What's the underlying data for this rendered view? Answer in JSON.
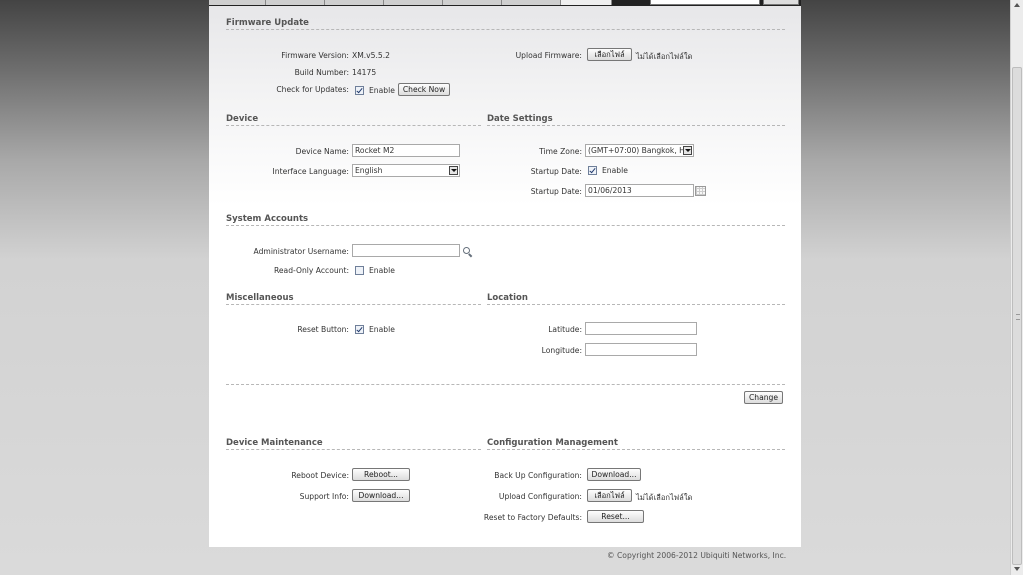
{
  "firmware": {
    "title": "Firmware Update",
    "version_label": "Firmware Version:",
    "version_value": "XM.v5.5.2",
    "build_label": "Build Number:",
    "build_value": "14175",
    "check_label": "Check for Updates:",
    "check_enable": "Enable",
    "check_now": "Check Now",
    "upload_label": "Upload Firmware:",
    "choose_file": "เลือกไฟล์",
    "no_file": "ไม่ได้เลือกไฟล์ใด"
  },
  "device": {
    "title": "Device",
    "name_label": "Device Name:",
    "name_value": "Rocket M2",
    "lang_label": "Interface Language:",
    "lang_value": "English"
  },
  "date": {
    "title": "Date Settings",
    "tz_label": "Time Zone:",
    "tz_value": "(GMT+07:00) Bangkok, H",
    "startup_label": "Startup Date:",
    "startup_enable": "Enable",
    "startup_date_label": "Startup Date:",
    "startup_date_value": "01/06/2013"
  },
  "accounts": {
    "title": "System Accounts",
    "admin_label": "Administrator Username:",
    "admin_value": "",
    "readonly_label": "Read-Only Account:",
    "readonly_enable": "Enable"
  },
  "misc": {
    "title": "Miscellaneous",
    "reset_label": "Reset Button:",
    "reset_enable": "Enable"
  },
  "location": {
    "title": "Location",
    "lat_label": "Latitude:",
    "lat_value": "",
    "lon_label": "Longitude:",
    "lon_value": ""
  },
  "change_button": "Change",
  "maintenance": {
    "title": "Device Maintenance",
    "reboot_label": "Reboot Device:",
    "reboot_button": "Reboot...",
    "support_label": "Support Info:",
    "support_button": "Download..."
  },
  "config": {
    "title": "Configuration Management",
    "backup_label": "Back Up Configuration:",
    "backup_button": "Download...",
    "upload_label": "Upload Configuration:",
    "choose_file": "เลือกไฟล์",
    "no_file": "ไม่ได้เลือกไฟล์ใด",
    "factory_label": "Reset to Factory Defaults:",
    "factory_button": "Reset..."
  },
  "footer": {
    "copyright": "© Copyright 2006-2012 Ubiquiti Networks, Inc."
  }
}
